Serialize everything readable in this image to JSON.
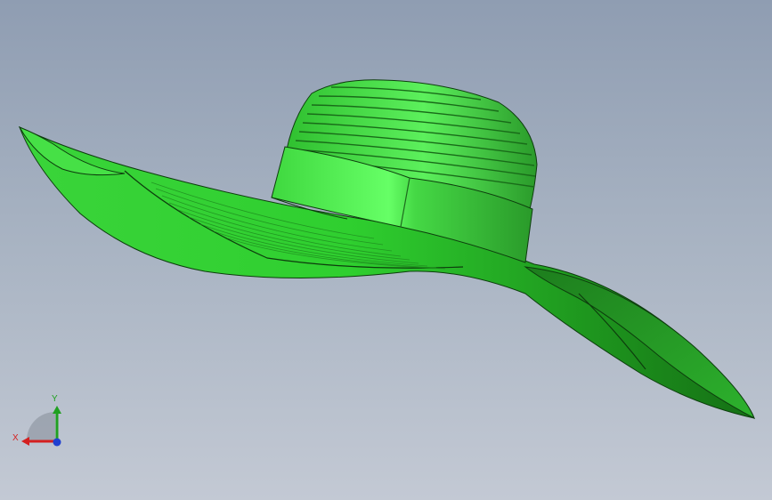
{
  "viewport": {
    "background_top": "#8f9db2",
    "background_bottom": "#c3c9d4"
  },
  "model": {
    "color": "#33cc33",
    "highlight": "#66ff66",
    "shadow": "#1f7a1f"
  },
  "triad": {
    "x_label": "X",
    "y_label": "Y",
    "x_color": "#d42020",
    "y_color": "#20a020",
    "z_color": "#2040d0"
  }
}
